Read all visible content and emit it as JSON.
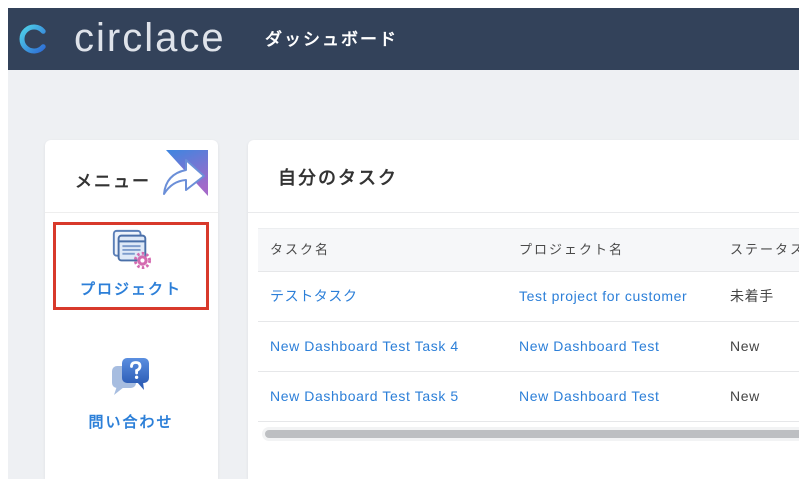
{
  "header": {
    "logo_text": "circlace",
    "logo_icon": "circlace-c-logo-icon",
    "page_title": "ダッシュボード"
  },
  "menu": {
    "title": "メニュー",
    "title_icon": "curved-arrow-icon",
    "items": [
      {
        "label": "プロジェクト",
        "icon": "project-icon",
        "highlighted": true
      },
      {
        "label": "問い合わせ",
        "icon": "inquiry-question-icon",
        "highlighted": false
      }
    ]
  },
  "tasks": {
    "title": "自分のタスク",
    "columns": [
      "タスク名",
      "プロジェクト名",
      "ステータス"
    ],
    "rows": [
      {
        "task": "テストタスク",
        "project": "Test project for customer",
        "status": "未着手"
      },
      {
        "task": "New Dashboard Test Task 4",
        "project": "New Dashboard Test",
        "status": "New"
      },
      {
        "task": "New Dashboard Test Task 5",
        "project": "New Dashboard Test",
        "status": "New"
      }
    ]
  },
  "colors": {
    "header_bg": "#33425a",
    "page_bg": "#eef0f3",
    "link": "#2c7fd8",
    "highlight_border": "#d8392b",
    "logo_gradient": [
      "#4fd1e8",
      "#2f6fd6"
    ]
  }
}
